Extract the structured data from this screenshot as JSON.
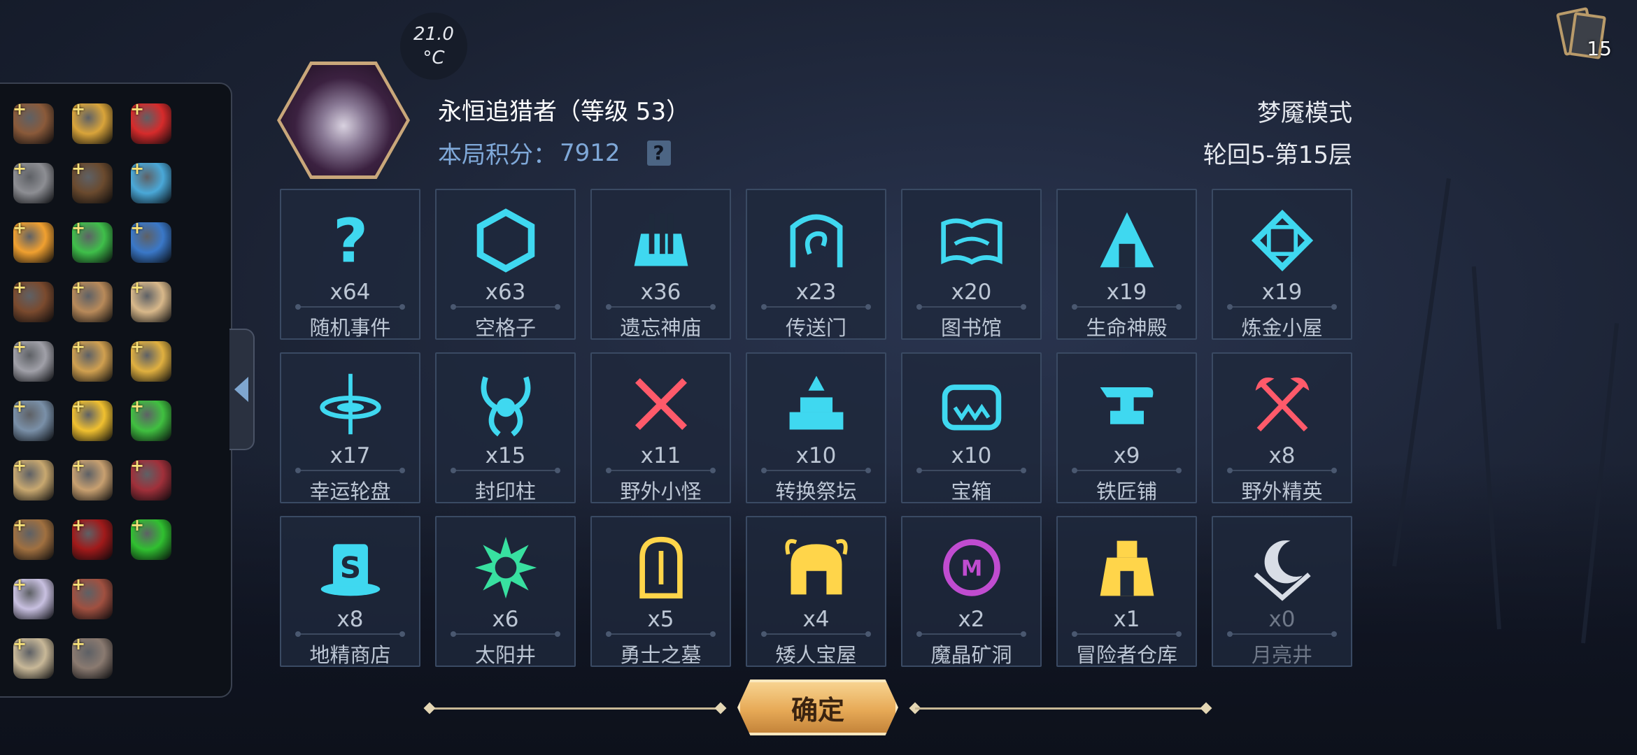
{
  "temperature": {
    "value": "21.0",
    "unit": "°C"
  },
  "card_count": "15",
  "player": {
    "name": "永恒追猎者（等级 53）",
    "score_label": "本局积分：",
    "score_value": "7912",
    "help_glyph": "?"
  },
  "mode": "梦魇模式",
  "floor": "轮回5-第15层",
  "confirm_label": "确定",
  "colors": {
    "accent_cyan": "#3fd8f0",
    "accent_red": "#ff5a6a",
    "accent_gold": "#ffd54a",
    "accent_purple": "#c04cd0",
    "accent_green": "#38e0a0"
  },
  "inventory_items": [
    {
      "icon": "spellbook-icon",
      "color": "#8a5a3a"
    },
    {
      "icon": "golden-gauntlet-icon",
      "color": "#d9a43a"
    },
    {
      "icon": "red-apple-icon",
      "color": "#d62b2b"
    },
    {
      "icon": "spiked-ring-icon",
      "color": "#8d8e93"
    },
    {
      "icon": "tome-icon",
      "color": "#6a4a2e"
    },
    {
      "icon": "magic-flask-icon",
      "color": "#4aa8d8"
    },
    {
      "icon": "starfish-icon",
      "color": "#f0a030"
    },
    {
      "icon": "green-potion-icon",
      "color": "#3fbf4a"
    },
    {
      "icon": "blue-gem-icon",
      "color": "#3a78c8"
    },
    {
      "icon": "brown-book-icon",
      "color": "#7a4a2e"
    },
    {
      "icon": "pouch-icon",
      "color": "#b88a5a"
    },
    {
      "icon": "scroll-icon",
      "color": "#d8b88a"
    },
    {
      "icon": "skull-box-icon",
      "color": "#a0a0a8"
    },
    {
      "icon": "map-icon",
      "color": "#d0a050"
    },
    {
      "icon": "golden-key-icon",
      "color": "#e0b040"
    },
    {
      "icon": "hammer-icon",
      "color": "#7a90a8"
    },
    {
      "icon": "gold-bars-icon",
      "color": "#f0c030"
    },
    {
      "icon": "green-slime-icon",
      "color": "#40c040"
    },
    {
      "icon": "scarecrow-icon",
      "color": "#c8a870"
    },
    {
      "icon": "parchment-icon",
      "color": "#c8a070"
    },
    {
      "icon": "berries-icon",
      "color": "#a0303a"
    },
    {
      "icon": "slingshot-icon",
      "color": "#a07040"
    },
    {
      "icon": "red-heart-icon",
      "color": "#a01a1a"
    },
    {
      "icon": "green-flask-icon",
      "color": "#30c030"
    },
    {
      "icon": "feather-icon",
      "color": "#c8c0e0"
    },
    {
      "icon": "meat-icon",
      "color": "#a05040"
    },
    null,
    {
      "icon": "beast-skull-icon",
      "color": "#c8b898"
    },
    {
      "icon": "claw-icon",
      "color": "#8a7a70"
    },
    null
  ],
  "tiles": [
    {
      "icon": "question-icon",
      "color": "#3fd8f0",
      "count": "x64",
      "label": "随机事件"
    },
    {
      "icon": "hexagon-icon",
      "color": "#3fd8f0",
      "count": "x63",
      "label": "空格子"
    },
    {
      "icon": "temple-icon",
      "color": "#3fd8f0",
      "count": "x36",
      "label": "遗忘神庙"
    },
    {
      "icon": "portal-icon",
      "color": "#3fd8f0",
      "count": "x23",
      "label": "传送门"
    },
    {
      "icon": "book-icon",
      "color": "#3fd8f0",
      "count": "x20",
      "label": "图书馆"
    },
    {
      "icon": "life-shrine-icon",
      "color": "#3fd8f0",
      "count": "x19",
      "label": "生命神殿"
    },
    {
      "icon": "alchemy-icon",
      "color": "#3fd8f0",
      "count": "x19",
      "label": "炼金小屋"
    },
    {
      "icon": "wheel-icon",
      "color": "#3fd8f0",
      "count": "x17",
      "label": "幸运轮盘"
    },
    {
      "icon": "seal-pillar-icon",
      "color": "#3fd8f0",
      "count": "x15",
      "label": "封印柱"
    },
    {
      "icon": "crossed-swords-icon",
      "color": "#ff5a6a",
      "count": "x11",
      "label": "野外小怪"
    },
    {
      "icon": "altar-icon",
      "color": "#3fd8f0",
      "count": "x10",
      "label": "转换祭坛"
    },
    {
      "icon": "chest-icon",
      "color": "#3fd8f0",
      "count": "x10",
      "label": "宝箱"
    },
    {
      "icon": "anvil-icon",
      "color": "#3fd8f0",
      "count": "x9",
      "label": "铁匠铺"
    },
    {
      "icon": "crossed-axes-icon",
      "color": "#ff5a6a",
      "count": "x8",
      "label": "野外精英"
    },
    {
      "icon": "top-hat-icon",
      "color": "#3fd8f0",
      "count": "x8",
      "label": "地精商店"
    },
    {
      "icon": "sun-well-icon",
      "color": "#38e0a0",
      "count": "x6",
      "label": "太阳井"
    },
    {
      "icon": "tombstone-icon",
      "color": "#ffd54a",
      "count": "x5",
      "label": "勇士之墓"
    },
    {
      "icon": "dwarf-helmet-icon",
      "color": "#ffd54a",
      "count": "x4",
      "label": "矮人宝屋"
    },
    {
      "icon": "crystal-cave-icon",
      "color": "#c04cd0",
      "count": "x2",
      "label": "魔晶矿洞"
    },
    {
      "icon": "warehouse-icon",
      "color": "#ffd54a",
      "count": "x1",
      "label": "冒险者仓库"
    },
    {
      "icon": "moon-well-icon",
      "color": "#d8dde6",
      "count": "x0",
      "label": "月亮井",
      "dim": true
    }
  ]
}
